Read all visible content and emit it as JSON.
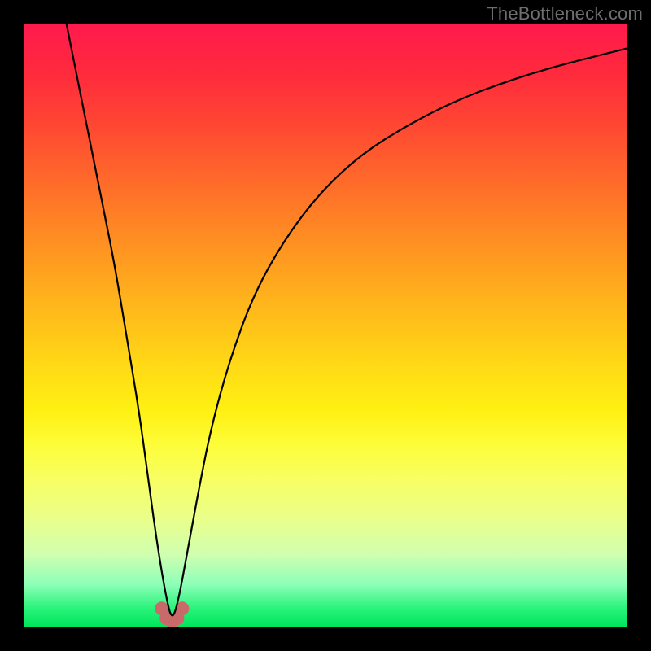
{
  "watermark": {
    "text": "TheBottleneck.com"
  },
  "chart_data": {
    "type": "line",
    "title": "",
    "xlabel": "",
    "ylabel": "",
    "xlim": [
      0,
      100
    ],
    "ylim": [
      0,
      100
    ],
    "grid": false,
    "legend": false,
    "series": [
      {
        "name": "curve",
        "x": [
          7,
          9,
          11,
          13,
          15,
          17,
          19,
          20.5,
          22,
          23.5,
          24.5,
          25.5,
          27,
          29,
          31,
          34,
          38,
          43,
          49,
          56,
          64,
          72,
          80,
          88,
          96,
          100
        ],
        "values": [
          100,
          90,
          80,
          70,
          60,
          48,
          36,
          25,
          14,
          5,
          1,
          4,
          12,
          23,
          33,
          44,
          55,
          64,
          72,
          78.5,
          83.5,
          87.5,
          90.5,
          93,
          95,
          96
        ]
      }
    ],
    "markers": {
      "name": "min-highlight",
      "points_xy": [
        [
          22.8,
          3.0
        ],
        [
          23.6,
          1.4
        ],
        [
          24.5,
          0.9
        ],
        [
          25.4,
          1.4
        ],
        [
          26.2,
          3.0
        ]
      ],
      "radius_px": 8.5,
      "color": "#c96a6a"
    },
    "background_gradient": {
      "direction": "top-to-bottom",
      "stops": [
        {
          "pos": 0.0,
          "color": "#ff1a4d"
        },
        {
          "pos": 0.5,
          "color": "#ffd716"
        },
        {
          "pos": 0.8,
          "color": "#f7ff66"
        },
        {
          "pos": 1.0,
          "color": "#00e65c"
        }
      ]
    }
  }
}
